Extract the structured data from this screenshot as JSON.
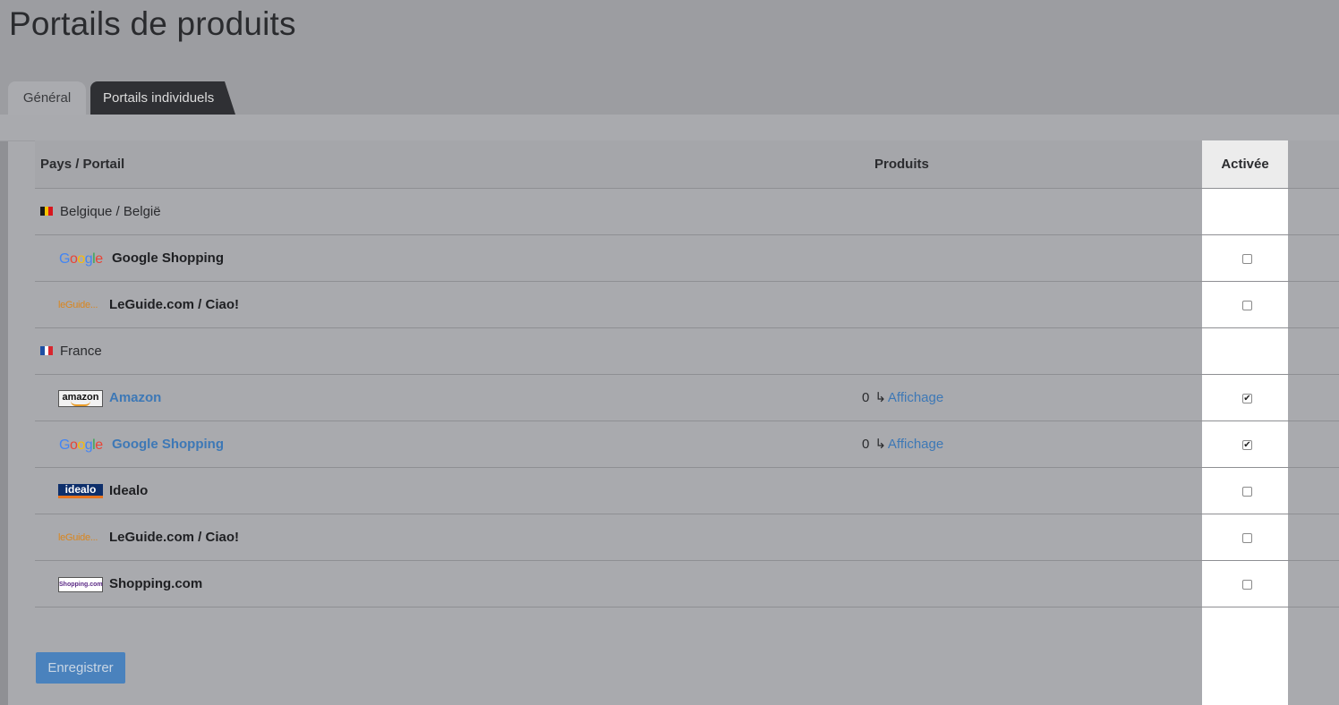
{
  "page": {
    "title": "Portails de produits"
  },
  "tabs": [
    {
      "label": "Général",
      "active": true
    },
    {
      "label": "Portails individuels",
      "active": false
    }
  ],
  "table": {
    "headers": {
      "portal": "Pays / Portail",
      "products": "Produits",
      "active": "Activée"
    },
    "countries": [
      {
        "name": "Belgique / België",
        "flag_colors": [
          "#1a1a1a",
          "#f5c400",
          "#d7161e"
        ],
        "portals": [
          {
            "name": "Google Shopping",
            "logo": "google-logo",
            "logo_text": "Google",
            "products_count": "",
            "products_link": "",
            "checked": false,
            "linked": false
          },
          {
            "name": "LeGuide.com / Ciao!",
            "logo": "leguide-logo",
            "logo_text": "leGuide...",
            "products_count": "",
            "products_link": "",
            "checked": false,
            "linked": false
          }
        ]
      },
      {
        "name": "France",
        "flag_colors": [
          "#1f4fa3",
          "#ffffff",
          "#d8262e"
        ],
        "portals": [
          {
            "name": "Amazon",
            "logo": "amazon-logo",
            "logo_text": "amazon",
            "products_count": "0",
            "products_link": "Affichage",
            "checked": true,
            "linked": true
          },
          {
            "name": "Google Shopping",
            "logo": "google-logo",
            "logo_text": "Google",
            "products_count": "0",
            "products_link": "Affichage",
            "checked": true,
            "linked": true
          },
          {
            "name": "Idealo",
            "logo": "idealo-logo",
            "logo_text": "idealo",
            "products_count": "",
            "products_link": "",
            "checked": false,
            "linked": false
          },
          {
            "name": "LeGuide.com / Ciao!",
            "logo": "leguide-logo",
            "logo_text": "leGuide...",
            "products_count": "",
            "products_link": "",
            "checked": false,
            "linked": false
          },
          {
            "name": "Shopping.com",
            "logo": "shopping-logo",
            "logo_text": "Shopping.com",
            "products_count": "",
            "products_link": "",
            "checked": false,
            "linked": false
          }
        ]
      }
    ],
    "arrow_glyph": "↳"
  },
  "actions": {
    "save_label": "Enregistrer"
  },
  "colors": {
    "link": "#3d78b6",
    "button": "#4a82bd",
    "tab_dark": "#2f3034"
  }
}
